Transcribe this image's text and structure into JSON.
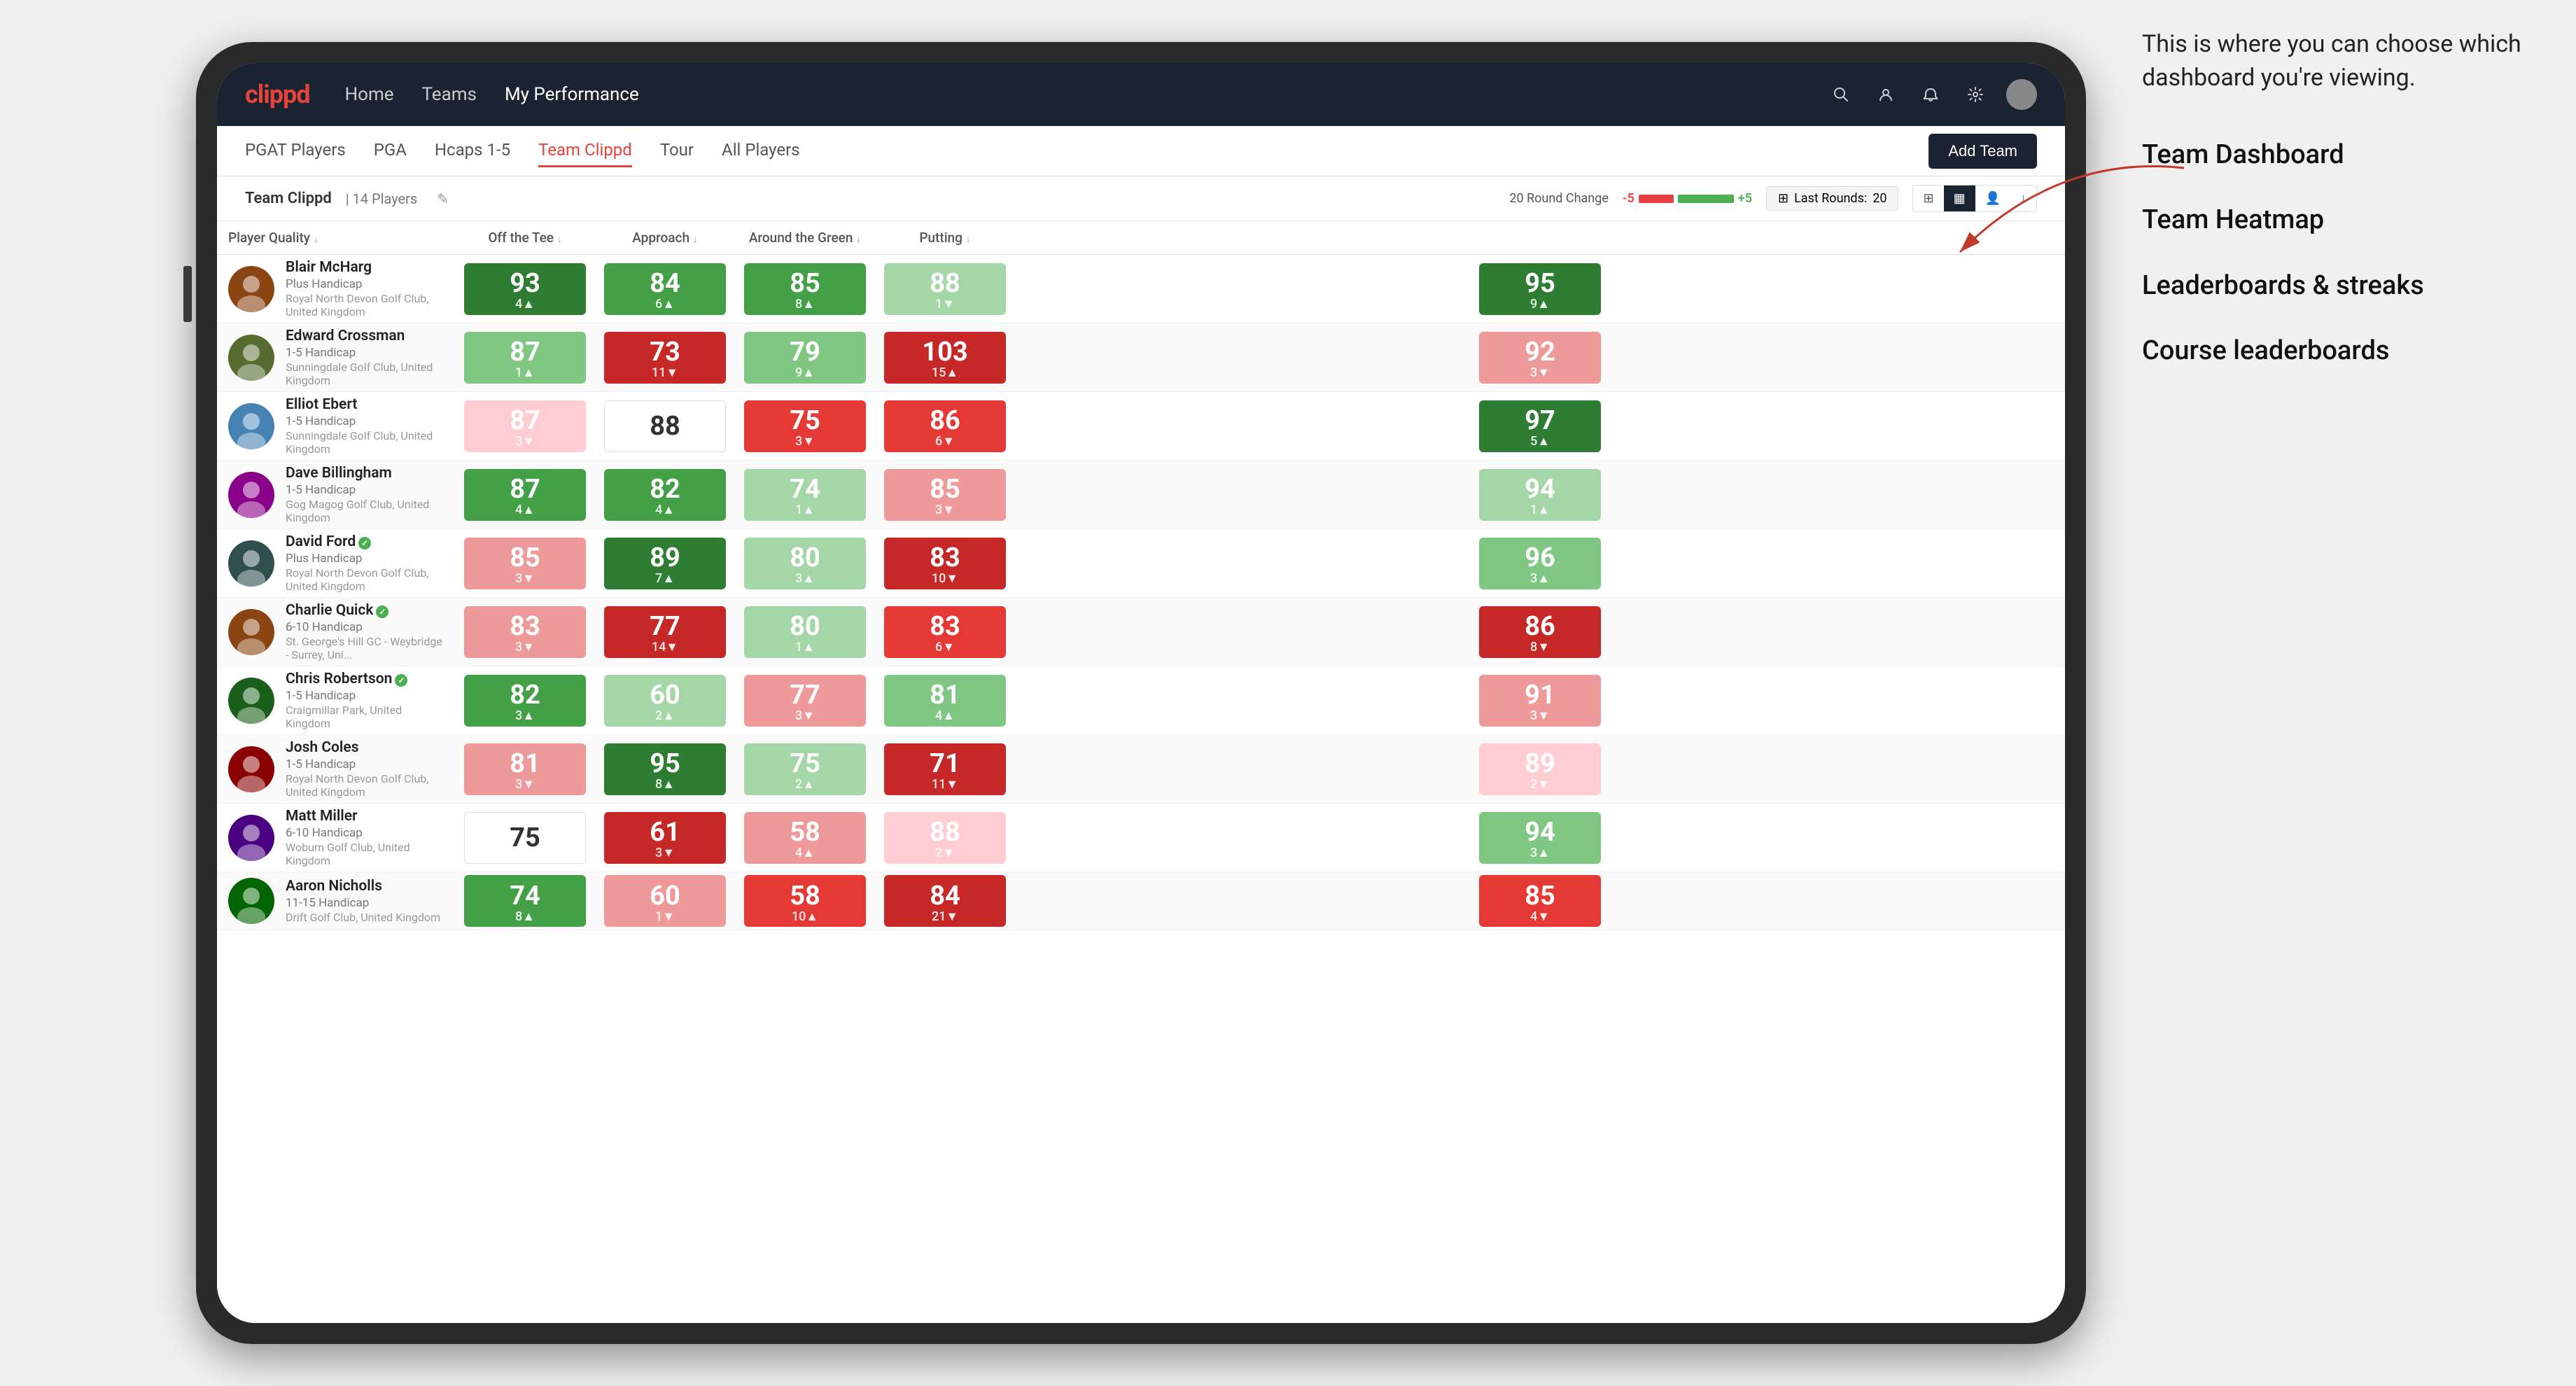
{
  "annotation": {
    "intro": "This is where you can choose which dashboard you're viewing.",
    "items": [
      "Team Dashboard",
      "Team Heatmap",
      "Leaderboards & streaks",
      "Course leaderboards"
    ]
  },
  "nav": {
    "logo": "clippd",
    "links": [
      "Home",
      "Teams",
      "My Performance"
    ],
    "active_link": "My Performance"
  },
  "sub_nav": {
    "links": [
      "PGAT Players",
      "PGA",
      "Hcaps 1-5",
      "Team Clippd",
      "Tour",
      "All Players"
    ],
    "active": "Team Clippd",
    "add_team_label": "Add Team"
  },
  "toolbar": {
    "team_name": "Team Clippd",
    "separator": "|",
    "player_count": "14 Players",
    "round_change_label": "20 Round Change",
    "round_neg": "-5",
    "round_pos": "+5",
    "last_rounds_label": "Last Rounds:",
    "last_rounds_value": "20"
  },
  "table": {
    "columns": [
      "Player Quality ↓",
      "Off the Tee ↓",
      "Approach ↓",
      "Around the Green ↓",
      "Putting ↓"
    ],
    "rows": [
      {
        "name": "Blair McHarg",
        "handicap": "Plus Handicap",
        "club": "Royal North Devon Golf Club, United Kingdom",
        "verified": false,
        "scores": [
          {
            "value": 93,
            "change": 4,
            "dir": "up",
            "color": "green-dark"
          },
          {
            "value": 84,
            "change": 6,
            "dir": "up",
            "color": "green-med"
          },
          {
            "value": 85,
            "change": 8,
            "dir": "up",
            "color": "green-med"
          },
          {
            "value": 88,
            "change": 1,
            "dir": "down",
            "color": "green-pale"
          },
          {
            "value": 95,
            "change": 9,
            "dir": "up",
            "color": "green-dark"
          }
        ]
      },
      {
        "name": "Edward Crossman",
        "handicap": "1-5 Handicap",
        "club": "Sunningdale Golf Club, United Kingdom",
        "verified": false,
        "scores": [
          {
            "value": 87,
            "change": 1,
            "dir": "up",
            "color": "green-light"
          },
          {
            "value": 73,
            "change": 11,
            "dir": "down",
            "color": "red-dark"
          },
          {
            "value": 79,
            "change": 9,
            "dir": "up",
            "color": "green-light"
          },
          {
            "value": 103,
            "change": 15,
            "dir": "up",
            "color": "red-dark"
          },
          {
            "value": 92,
            "change": 3,
            "dir": "down",
            "color": "red-light"
          }
        ]
      },
      {
        "name": "Elliot Ebert",
        "handicap": "1-5 Handicap",
        "club": "Sunningdale Golf Club, United Kingdom",
        "verified": false,
        "scores": [
          {
            "value": 87,
            "change": 3,
            "dir": "down",
            "color": "red-pale"
          },
          {
            "value": 88,
            "change": null,
            "dir": null,
            "color": "white-bg"
          },
          {
            "value": 75,
            "change": 3,
            "dir": "down",
            "color": "red-med"
          },
          {
            "value": 86,
            "change": 6,
            "dir": "down",
            "color": "red-med"
          },
          {
            "value": 97,
            "change": 5,
            "dir": "up",
            "color": "green-dark"
          }
        ]
      },
      {
        "name": "Dave Billingham",
        "handicap": "1-5 Handicap",
        "club": "Gog Magog Golf Club, United Kingdom",
        "verified": false,
        "scores": [
          {
            "value": 87,
            "change": 4,
            "dir": "up",
            "color": "green-med"
          },
          {
            "value": 82,
            "change": 4,
            "dir": "up",
            "color": "green-med"
          },
          {
            "value": 74,
            "change": 1,
            "dir": "up",
            "color": "green-pale"
          },
          {
            "value": 85,
            "change": 3,
            "dir": "down",
            "color": "red-light"
          },
          {
            "value": 94,
            "change": 1,
            "dir": "up",
            "color": "green-pale"
          }
        ]
      },
      {
        "name": "David Ford",
        "handicap": "Plus Handicap",
        "club": "Royal North Devon Golf Club, United Kingdom",
        "verified": true,
        "scores": [
          {
            "value": 85,
            "change": 3,
            "dir": "down",
            "color": "red-light"
          },
          {
            "value": 89,
            "change": 7,
            "dir": "up",
            "color": "green-dark"
          },
          {
            "value": 80,
            "change": 3,
            "dir": "up",
            "color": "green-pale"
          },
          {
            "value": 83,
            "change": 10,
            "dir": "down",
            "color": "red-dark"
          },
          {
            "value": 96,
            "change": 3,
            "dir": "up",
            "color": "green-light"
          }
        ]
      },
      {
        "name": "Charlie Quick",
        "handicap": "6-10 Handicap",
        "club": "St. George's Hill GC - Weybridge - Surrey, Uni...",
        "verified": true,
        "scores": [
          {
            "value": 83,
            "change": 3,
            "dir": "down",
            "color": "red-light"
          },
          {
            "value": 77,
            "change": 14,
            "dir": "down",
            "color": "red-dark"
          },
          {
            "value": 80,
            "change": 1,
            "dir": "up",
            "color": "green-pale"
          },
          {
            "value": 83,
            "change": 6,
            "dir": "down",
            "color": "red-med"
          },
          {
            "value": 86,
            "change": 8,
            "dir": "down",
            "color": "red-dark"
          }
        ]
      },
      {
        "name": "Chris Robertson",
        "handicap": "1-5 Handicap",
        "club": "Craigmillar Park, United Kingdom",
        "verified": true,
        "scores": [
          {
            "value": 82,
            "change": 3,
            "dir": "up",
            "color": "green-med"
          },
          {
            "value": 60,
            "change": 2,
            "dir": "up",
            "color": "green-pale"
          },
          {
            "value": 77,
            "change": 3,
            "dir": "down",
            "color": "red-light"
          },
          {
            "value": 81,
            "change": 4,
            "dir": "up",
            "color": "green-light"
          },
          {
            "value": 91,
            "change": 3,
            "dir": "down",
            "color": "red-light"
          }
        ]
      },
      {
        "name": "Josh Coles",
        "handicap": "1-5 Handicap",
        "club": "Royal North Devon Golf Club, United Kingdom",
        "verified": false,
        "scores": [
          {
            "value": 81,
            "change": 3,
            "dir": "down",
            "color": "red-light"
          },
          {
            "value": 95,
            "change": 8,
            "dir": "up",
            "color": "green-dark"
          },
          {
            "value": 75,
            "change": 2,
            "dir": "up",
            "color": "green-pale"
          },
          {
            "value": 71,
            "change": 11,
            "dir": "down",
            "color": "red-dark"
          },
          {
            "value": 89,
            "change": 2,
            "dir": "down",
            "color": "red-pale"
          }
        ]
      },
      {
        "name": "Matt Miller",
        "handicap": "6-10 Handicap",
        "club": "Woburn Golf Club, United Kingdom",
        "verified": false,
        "scores": [
          {
            "value": 75,
            "change": null,
            "dir": null,
            "color": "white-bg"
          },
          {
            "value": 61,
            "change": 3,
            "dir": "down",
            "color": "red-dark"
          },
          {
            "value": 58,
            "change": 4,
            "dir": "up",
            "color": "red-light"
          },
          {
            "value": 88,
            "change": 2,
            "dir": "down",
            "color": "red-pale"
          },
          {
            "value": 94,
            "change": 3,
            "dir": "up",
            "color": "green-light"
          }
        ]
      },
      {
        "name": "Aaron Nicholls",
        "handicap": "11-15 Handicap",
        "club": "Drift Golf Club, United Kingdom",
        "verified": false,
        "scores": [
          {
            "value": 74,
            "change": 8,
            "dir": "up",
            "color": "green-med"
          },
          {
            "value": 60,
            "change": 1,
            "dir": "down",
            "color": "red-light"
          },
          {
            "value": 58,
            "change": 10,
            "dir": "up",
            "color": "red-med"
          },
          {
            "value": 84,
            "change": 21,
            "dir": "down",
            "color": "red-dark"
          },
          {
            "value": 85,
            "change": 4,
            "dir": "down",
            "color": "red-med"
          }
        ]
      }
    ]
  },
  "colors": {
    "nav_bg": "#1a2332",
    "brand_red": "#e8433a",
    "green_dark": "#2e7d32",
    "green_med": "#43a047",
    "green_light": "#81c784",
    "green_pale": "#a5d6a7",
    "red_dark": "#c62828",
    "red_med": "#e53935",
    "red_light": "#ef9a9a",
    "red_pale": "#ffcdd2"
  }
}
